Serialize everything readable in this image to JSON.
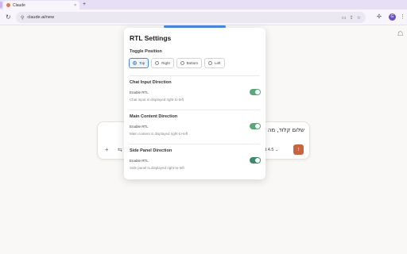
{
  "browser": {
    "tab_title": "Claude",
    "tab_close": "×",
    "new_tab": "+",
    "url": "claude.ai/new",
    "profile_initial": "G"
  },
  "composer": {
    "text": "שלום קלוד, מה שלו",
    "model_label": "ct 4.5",
    "plus": "+",
    "send": "↑"
  },
  "popup": {
    "title": "RTL Settings",
    "toggle_position": {
      "title": "Toggle Position",
      "options": [
        "Top",
        "Right",
        "Bottom",
        "Left"
      ],
      "selected": "Top"
    },
    "sections": [
      {
        "title": "Chat Input Direction",
        "enable_label": "Enable RTL",
        "description": "Chat input is displayed right-to-left",
        "enabled": true
      },
      {
        "title": "Main Content Direction",
        "enable_label": "Enable RTL",
        "description": "Main content is displayed right-to-left",
        "enabled": true
      },
      {
        "title": "Side Panel Direction",
        "enable_label": "Enable RTL",
        "description": "Side panel is displayed right-to-left",
        "enabled": true
      }
    ]
  },
  "colors": {
    "accent_blue": "#4a8be0",
    "toggle_green": "#5aa77a",
    "send_orange": "#c96442"
  }
}
